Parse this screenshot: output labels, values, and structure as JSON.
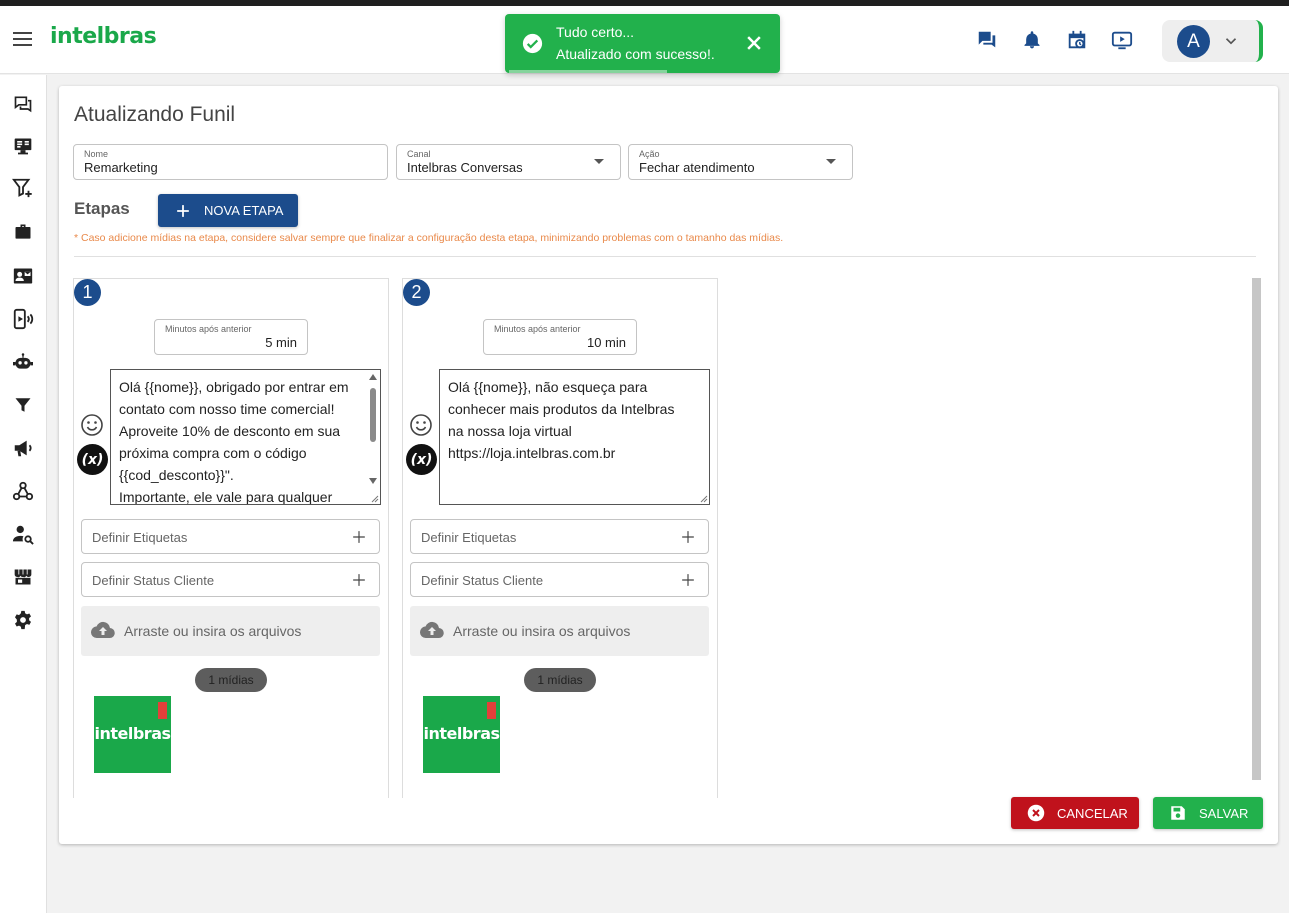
{
  "app": {
    "logo": "intelbras"
  },
  "toast": {
    "title": "Tudo certo...",
    "message": "Atualizado com sucesso!."
  },
  "user": {
    "initial": "A"
  },
  "page": {
    "title": "Atualizando Funil"
  },
  "form": {
    "nome": {
      "label": "Nome",
      "value": "Remarketing"
    },
    "canal": {
      "label": "Canal",
      "value": "Intelbras Conversas"
    },
    "acao": {
      "label": "Ação",
      "value": "Fechar atendimento"
    }
  },
  "etapas": {
    "label": "Etapas",
    "new_button": "NOVA ETAPA",
    "warning": "* Caso adicione mídias na etapa, considere salvar sempre que finalizar a configuração desta etapa, minimizando problemas com o tamanho das mídias."
  },
  "stages": [
    {
      "number": "1",
      "minutes_label": "Minutos após anterior",
      "minutes_value": "5 min",
      "message": "Olá {{nome}}, obrigado por entrar em contato com nosso time comercial! Aproveite 10% de desconto em sua próxima compra com o código {{cod_desconto}}\".\nImportante, ele vale para qualquer",
      "var_label": "(x)",
      "tags_label": "Definir Etiquetas",
      "status_label": "Definir Status Cliente",
      "dropzone_label": "Arraste ou insira os arquivos",
      "media_count": "1 mídias",
      "media_logo": "intelbras"
    },
    {
      "number": "2",
      "minutes_label": "Minutos após anterior",
      "minutes_value": "10 min",
      "message": "Olá {{nome}}, não esqueça para conhecer mais produtos da Intelbras na nossa loja virtual\nhttps://loja.intelbras.com.br",
      "var_label": "(x)",
      "tags_label": "Definir Etiquetas",
      "status_label": "Definir Status Cliente",
      "dropzone_label": "Arraste ou insira os arquivos",
      "media_count": "1 mídias",
      "media_logo": "intelbras"
    }
  ],
  "actions": {
    "cancel": "CANCELAR",
    "save": "SALVAR"
  },
  "colors": {
    "brand_green": "#1aa84a",
    "primary_blue": "#1c4c8c",
    "cancel_red": "#c0121c",
    "warning_orange": "#e9894a"
  }
}
